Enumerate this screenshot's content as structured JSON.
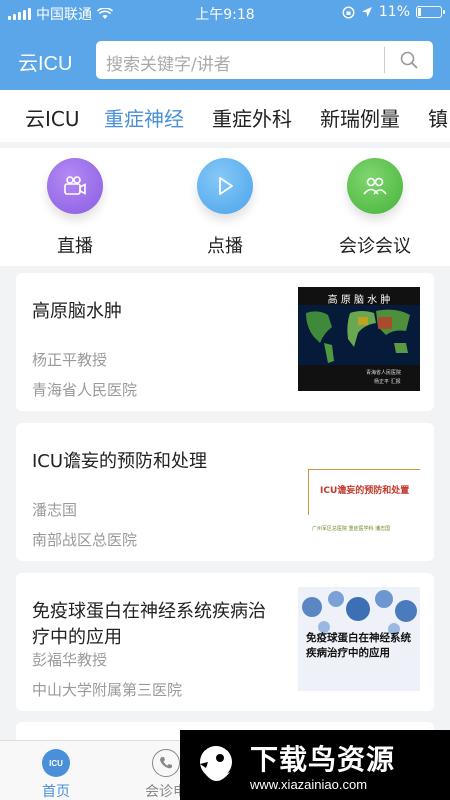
{
  "status_bar": {
    "carrier": "中国联通",
    "time": "上午9:18",
    "battery": "11%"
  },
  "header": {
    "app_title": "云ICU",
    "search_placeholder": "搜索关键字/讲者"
  },
  "categories": [
    "云ICU",
    "重症神经",
    "重症外科",
    "新瑞例量",
    "镇"
  ],
  "active_category": "重症神经",
  "quick_actions": [
    {
      "label": "直播",
      "icon": "video-camera-icon",
      "color": "#9b6fe8"
    },
    {
      "label": "点播",
      "icon": "play-icon",
      "color": "#5ab0f2"
    },
    {
      "label": "会诊会议",
      "icon": "people-icon",
      "color": "#5cc24e"
    }
  ],
  "lectures": [
    {
      "title": "高原脑水肿",
      "speaker": "杨正平教授",
      "hospital": "青海省人民医院",
      "thumb_title": "高 原 脑 水 肿",
      "thumb_caption_1": "青海省人民医院",
      "thumb_caption_2": "杨正平 汇报"
    },
    {
      "title": "ICU谵妄的预防和处理",
      "speaker": "潘志国",
      "hospital": "南部战区总医院",
      "thumb_title": "ICU谵妄的预防和处置",
      "thumb_caption": "广州军区总医院 重症医学科 潘志国"
    },
    {
      "title": "免疫球蛋白在神经系统疾病治疗中的应用",
      "speaker": "彭福华教授",
      "hospital": "中山大学附属第三医院",
      "thumb_title": "免疫球蛋白在神经系统疾病治疗中的应用"
    }
  ],
  "bottom_nav": [
    {
      "label": "首页",
      "icon": "icu-home-icon",
      "active": true
    },
    {
      "label": "会诊电",
      "icon": "phone-icon",
      "active": false
    }
  ],
  "watermark": {
    "title": "下载鸟资源",
    "url": "www.xiazainiao.com"
  },
  "colors": {
    "primary": "#5ba6e8",
    "active_tab": "#4a90d9",
    "muted_text": "#9a9a9a"
  }
}
